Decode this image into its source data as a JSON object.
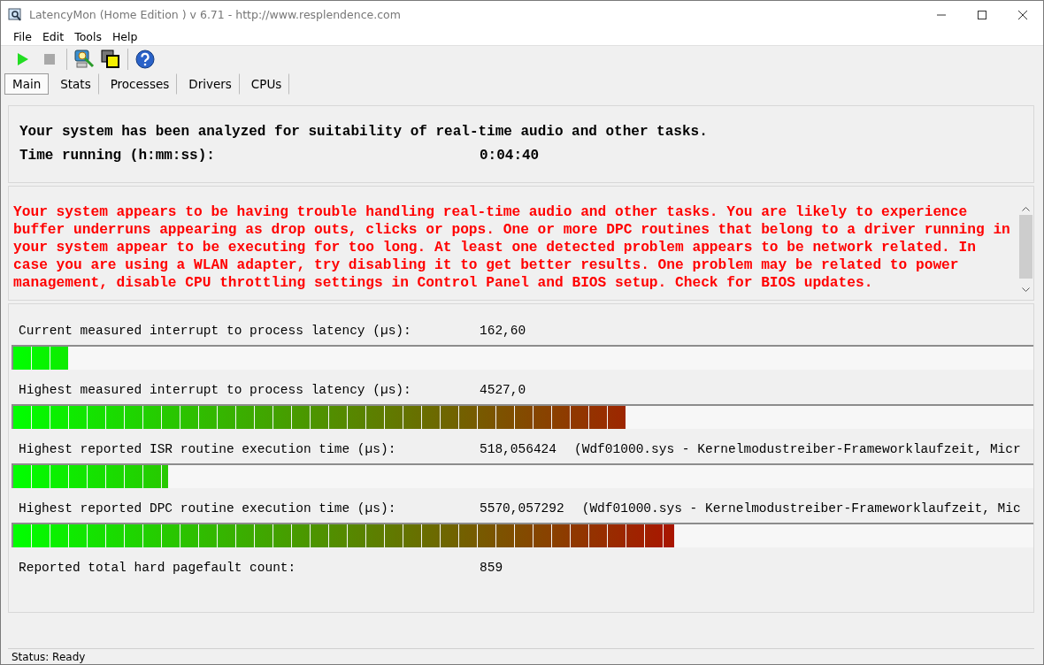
{
  "window": {
    "title": "LatencyMon  (Home Edition )  v 6.71 - http://www.resplendence.com"
  },
  "menu": [
    {
      "label": "File"
    },
    {
      "label": "Edit"
    },
    {
      "label": "Tools"
    },
    {
      "label": "Help"
    }
  ],
  "toolbar": [
    {
      "kind": "play",
      "disabled": false
    },
    {
      "kind": "stop",
      "disabled": true
    },
    {
      "kind": "analyze",
      "disabled": false
    },
    {
      "kind": "windows",
      "disabled": false
    },
    {
      "kind": "help",
      "disabled": false
    }
  ],
  "tabs": [
    {
      "label": "Main",
      "selected": true
    },
    {
      "label": "Stats",
      "selected": false
    },
    {
      "label": "Processes",
      "selected": false
    },
    {
      "label": "Drivers",
      "selected": false
    },
    {
      "label": "CPUs",
      "selected": false
    }
  ],
  "summary": {
    "headline": "Your system has been analyzed for suitability of real-time audio and other tasks.",
    "time_label": "Time running (h:mm:ss):",
    "time_value": "0:04:40"
  },
  "verdict": "Your system appears to be having trouble handling real-time audio and other tasks. You are likely to experience buffer underruns appearing as drop outs, clicks or pops. One or more DPC routines that belong to a driver running in your system appear to be executing for too long. At least one detected problem appears to be network related. In case you are using a WLAN adapter, try disabling it to get better results. One problem may be related to power management, disable CPU throttling settings in Control Panel and BIOS setup. Check for BIOS updates.",
  "measurements": [
    {
      "label": "Current measured interrupt to process latency (µs):",
      "value": "162,60",
      "level": 0.054
    },
    {
      "label": "Highest measured interrupt to process latency (µs):",
      "value": "4527,0",
      "level": 0.6
    },
    {
      "label": "Highest reported ISR routine execution time (µs):",
      "value": "518,056424",
      "detail": "(Wdf01000.sys - Kernelmodustreiber-Frameworklaufzeit, Micr",
      "level": 0.152
    },
    {
      "label": "Highest reported DPC routine execution time (µs):",
      "value": "5570,057292",
      "detail": "(Wdf01000.sys - Kernelmodustreiber-Frameworklaufzeit, Mic",
      "level": 0.648
    },
    {
      "label": "Reported total hard pagefault count:",
      "value": "859"
    }
  ],
  "status_bar": "Status: Ready"
}
